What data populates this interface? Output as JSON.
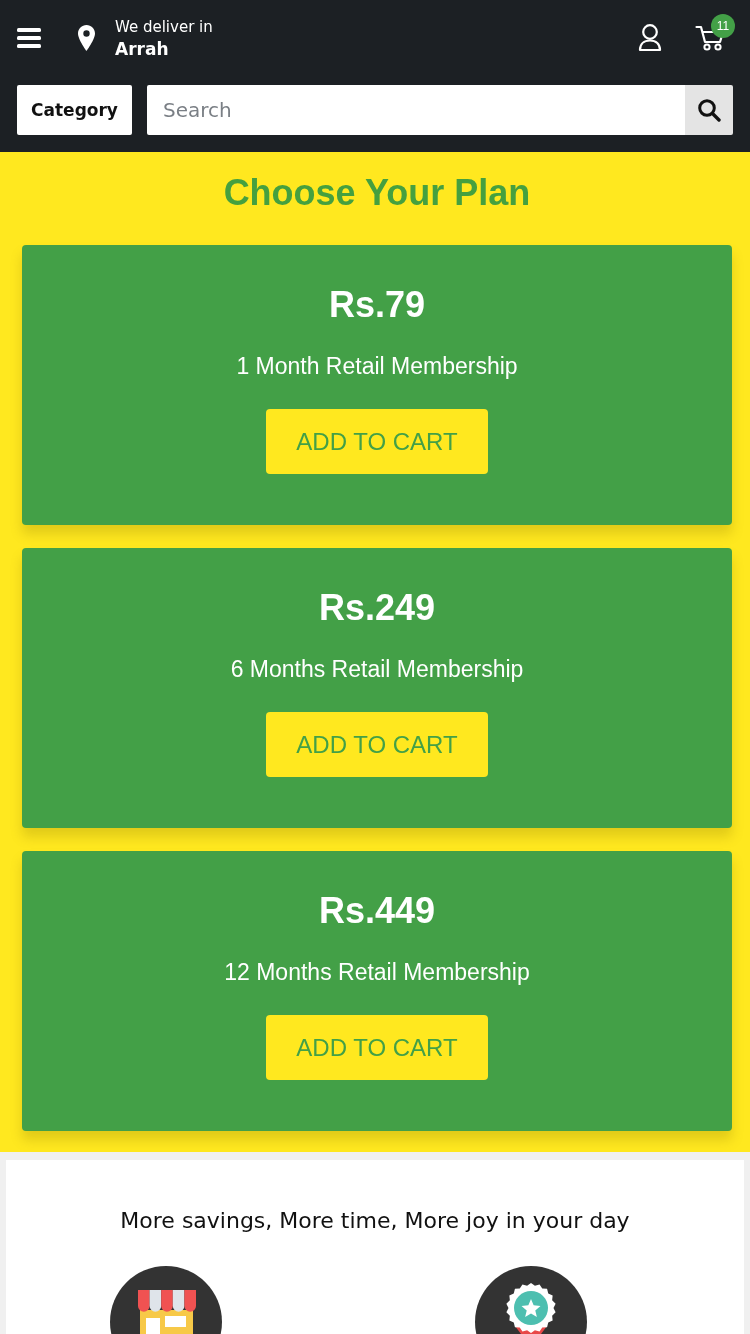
{
  "header": {
    "location": {
      "label": "We deliver in",
      "city": "Arrah"
    },
    "cart": {
      "count": "11"
    },
    "category_button": "Category",
    "search": {
      "placeholder": "Search"
    }
  },
  "plans_section": {
    "title": "Choose Your Plan",
    "plans": [
      {
        "price": "Rs.79",
        "name": "1 Month Retail Membership",
        "button": "ADD TO CART"
      },
      {
        "price": "Rs.249",
        "name": "6 Months Retail Membership",
        "button": "ADD TO CART"
      },
      {
        "price": "Rs.449",
        "name": "12 Months Retail Membership",
        "button": "ADD TO CART"
      }
    ]
  },
  "benefits": {
    "heading": "More savings, More time, More joy in your day",
    "items": [
      {
        "kind": "store"
      },
      {
        "kind": "award"
      }
    ]
  }
}
